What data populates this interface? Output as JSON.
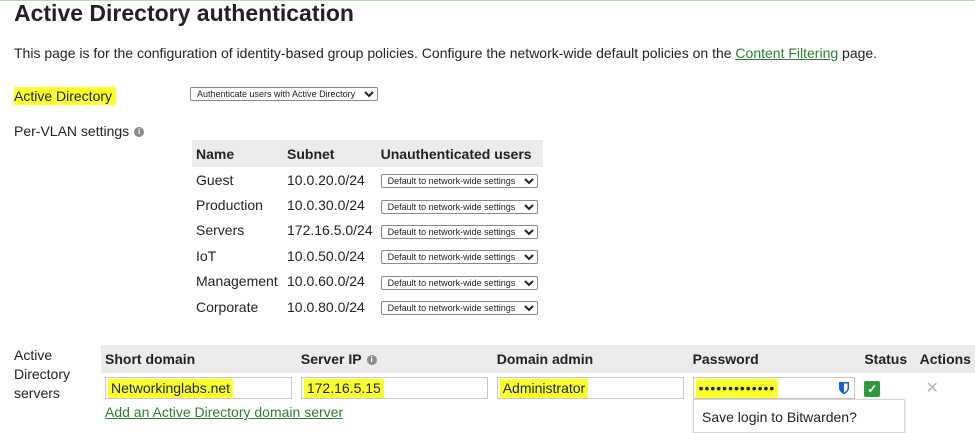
{
  "page": {
    "title": "Active Directory authentication",
    "intro_text": "This page is for the configuration of identity-based group policies. Configure the network-wide default policies on the ",
    "intro_link": "Content Filtering",
    "intro_suffix": " page."
  },
  "active_directory": {
    "label": "Active Directory",
    "selected": "Authenticate users with Active Directory"
  },
  "per_vlan": {
    "label": "Per-VLAN settings",
    "columns": [
      "Name",
      "Subnet",
      "Unauthenticated users"
    ],
    "rows": [
      {
        "name": "Guest",
        "subnet": "10.0.20.0/24",
        "policy": "Default to network-wide settings"
      },
      {
        "name": "Production",
        "subnet": "10.0.30.0/24",
        "policy": "Default to network-wide settings"
      },
      {
        "name": "Servers",
        "subnet": "172.16.5.0/24",
        "policy": "Default to network-wide settings"
      },
      {
        "name": "IoT",
        "subnet": "10.0.50.0/24",
        "policy": "Default to network-wide settings"
      },
      {
        "name": "Management",
        "subnet": "10.0.60.0/24",
        "policy": "Default to network-wide settings"
      },
      {
        "name": "Corporate",
        "subnet": "10.0.80.0/24",
        "policy": "Default to network-wide settings"
      }
    ]
  },
  "ad_servers": {
    "label": "Active Directory servers",
    "columns": [
      "Short domain",
      "Server IP",
      "Domain admin",
      "Password",
      "Status",
      "Actions"
    ],
    "row": {
      "short_domain": "Networkinglabs.net",
      "server_ip": "172.16.5.15",
      "domain_admin": "Administrator",
      "password_mask": "•••••••••••••"
    },
    "add_link": "Add an Active Directory domain server"
  },
  "bitwarden_popup": {
    "text": "Save login to Bitwarden?"
  },
  "colors": {
    "highlight": "#fbff2a",
    "link": "#2e7d32",
    "header_bg": "#ebebeb",
    "status_ok": "#2e9a3e",
    "bitwarden": "#175ddc"
  },
  "icons": {
    "info": "info-icon",
    "status": "check-icon",
    "remove": "close-icon",
    "password_manager": "bitwarden-shield-icon"
  }
}
